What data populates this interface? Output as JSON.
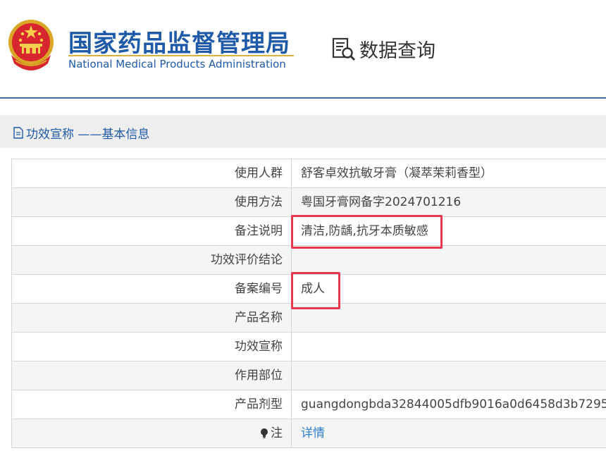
{
  "header": {
    "title_cn": "国家药品监督管理局",
    "title_en": "National Medical Products Administration",
    "query_label": "数据查询"
  },
  "section": {
    "title": "功效宣称 ——基本信息"
  },
  "rows": [
    {
      "label": "使用人群",
      "value": "舒客卓效抗敏牙膏（凝萃茉莉香型）"
    },
    {
      "label": "使用方法",
      "value": "粤国牙膏网备字2024701216"
    },
    {
      "label": "备注说明",
      "value": "清洁,防龋,抗牙本质敏感"
    },
    {
      "label": "功效评价结论",
      "value": ""
    },
    {
      "label": "备案编号",
      "value": "成人"
    },
    {
      "label": "产品名称",
      "value": ""
    },
    {
      "label": "功效宣称",
      "value": ""
    },
    {
      "label": "作用部位",
      "value": ""
    },
    {
      "label": "产品剂型",
      "value": "guangdongbda32844005dfb9016a0d6458d3b7295"
    },
    {
      "label": "注",
      "value": "详情"
    }
  ],
  "colors": {
    "brand_blue": "#1e5aa8",
    "highlight_red": "#e8384d",
    "link_blue": "#2f7fd1"
  }
}
